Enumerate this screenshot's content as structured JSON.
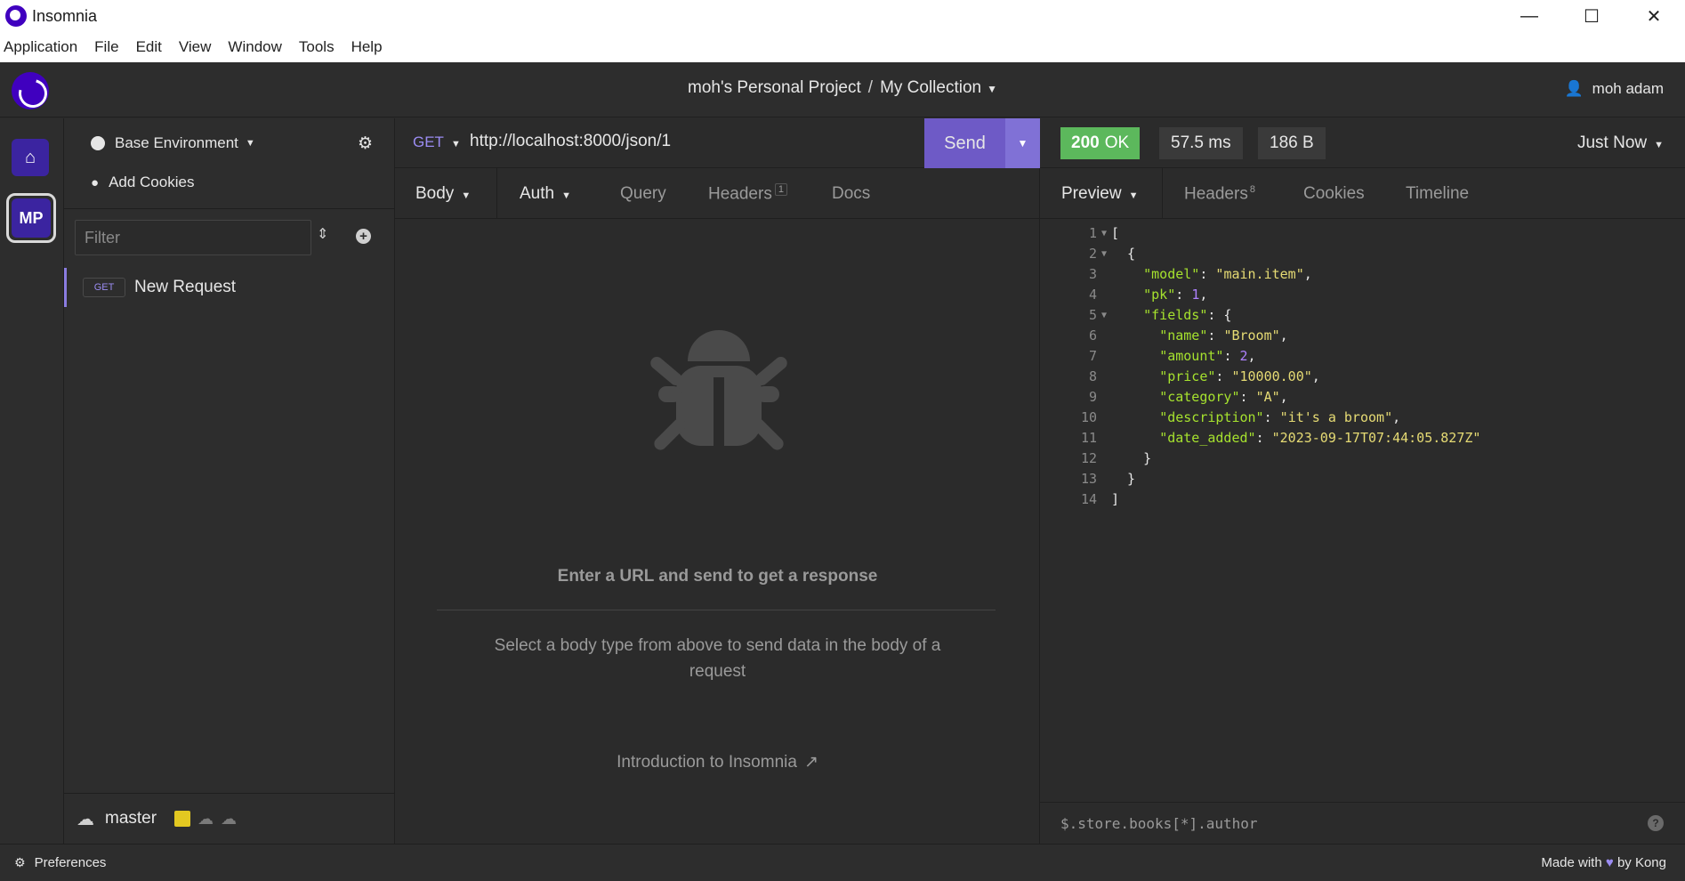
{
  "window": {
    "title": "Insomnia",
    "minimize": "—",
    "maximize": "☐",
    "close": "✕"
  },
  "menu": [
    "Application",
    "File",
    "Edit",
    "View",
    "Window",
    "Tools",
    "Help"
  ],
  "header": {
    "project": "moh's Personal Project",
    "separator": "/",
    "collection": "My Collection",
    "user": "moh adam"
  },
  "rail": {
    "workspace_initials": "MP"
  },
  "sidebar": {
    "environment": "Base Environment",
    "add_cookies": "Add Cookies",
    "filter_placeholder": "Filter",
    "request": {
      "method": "GET",
      "name": "New Request"
    },
    "branch": "master"
  },
  "request": {
    "method": "GET",
    "url": "http://localhost:8000/json/1",
    "send_label": "Send",
    "tabs": {
      "body": "Body",
      "auth": "Auth",
      "query": "Query",
      "headers": "Headers",
      "headers_count": "1",
      "docs": "Docs"
    },
    "empty_title": "Enter a URL and send to get a response",
    "empty_sub": "Select a body type from above to send data in the body of a request",
    "intro_link": "Introduction to Insomnia"
  },
  "response": {
    "status_code": "200",
    "status_text": "OK",
    "time": "57.5 ms",
    "size": "186 B",
    "timestamp": "Just Now",
    "tabs": {
      "preview": "Preview",
      "headers": "Headers",
      "headers_count": "8",
      "cookies": "Cookies",
      "timeline": "Timeline"
    },
    "json_filter_placeholder": "$.store.books[*].author",
    "help": "?"
  },
  "response_body": {
    "model": "main.item",
    "pk": "1",
    "name": "Broom",
    "amount": "2",
    "price": "10000.00",
    "category": "A",
    "description": "it's a broom",
    "date_added": "2023-09-17T07:44:05.827Z"
  },
  "footer": {
    "preferences": "Preferences",
    "made_with": "Made with",
    "by_kong": "by Kong"
  },
  "colors": {
    "accent": "#6e5ac6",
    "status_ok": "#5cb85c",
    "brand": "#4000bf"
  }
}
